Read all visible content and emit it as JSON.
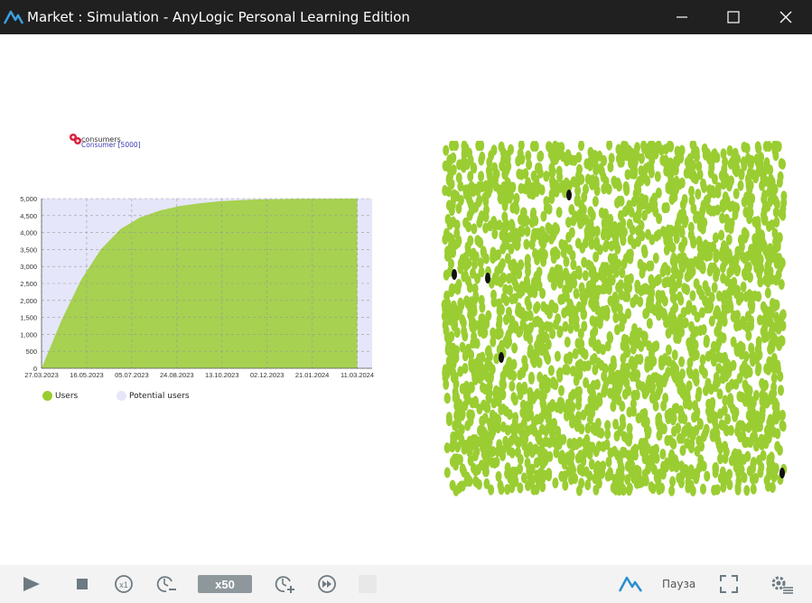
{
  "window": {
    "title": "Market : Simulation - AnyLogic Personal Learning Edition",
    "minimize_icon": "minimize-icon",
    "maximize_icon": "maximize-icon",
    "close_icon": "close-icon"
  },
  "population": {
    "name": "consumers",
    "type_label": "Consumer [5000]"
  },
  "chart_data": {
    "type": "area",
    "title": "",
    "xlabel": "",
    "ylabel": "",
    "ylim": [
      0,
      5000
    ],
    "yticks": [
      "0",
      "500",
      "1,000",
      "1,500",
      "2,000",
      "2,500",
      "3,000",
      "3,500",
      "4,000",
      "4,500",
      "5,000"
    ],
    "xticks": [
      "27.03.2023",
      "16.05.2023",
      "05.07.2023",
      "24.08.2023",
      "13.10.2023",
      "02.12.2023",
      "21.01.2024",
      "11.03.2024"
    ],
    "grid": true,
    "legend_position": "bottom-left",
    "series": [
      {
        "name": "Users",
        "color": "#9acd32",
        "values": [
          0,
          1400,
          2600,
          3500,
          4100,
          4450,
          4650,
          4780,
          4860,
          4920,
          4955,
          4975,
          4985,
          4992,
          4996,
          4998,
          5000
        ]
      },
      {
        "name": "Potential users",
        "color": "#e6e6fa",
        "values": [
          5000,
          3600,
          2400,
          1500,
          900,
          550,
          350,
          220,
          140,
          80,
          45,
          25,
          15,
          8,
          4,
          2,
          0
        ]
      }
    ]
  },
  "toolbar": {
    "run_icon": "play-icon",
    "stop_icon": "stop-icon",
    "realtime_label": "x1",
    "slower_icon": "slow-down-icon",
    "speed_label": "x50",
    "faster_icon": "speed-up-icon",
    "fast_forward_icon": "fast-forward-icon",
    "status_label": "Пауза",
    "logo_icon": "anylogic-logo-icon",
    "fullscreen_icon": "fullscreen-icon",
    "settings_icon": "settings-icon"
  },
  "colors": {
    "title_bar": "#202020",
    "agent_green": "#9acd32",
    "potential_color": "#e6e6fa",
    "toolbar_bg": "#f3f3f3"
  }
}
